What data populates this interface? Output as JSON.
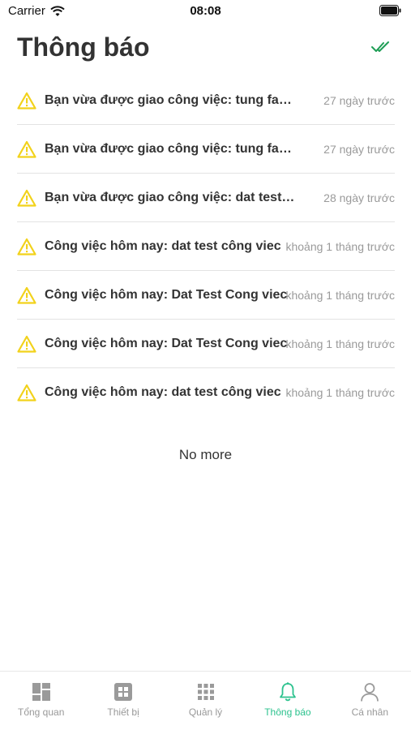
{
  "status_bar": {
    "carrier": "Carrier",
    "time": "08:08"
  },
  "header": {
    "title": "Thông báo",
    "mark_all_icon": "double-check-icon"
  },
  "notifications": [
    {
      "icon": "warning-icon",
      "message": "Bạn vừa được giao công việc: tung faker",
      "time_ago": "27 ngày trước"
    },
    {
      "icon": "warning-icon",
      "message": "Bạn vừa được giao công việc: tung faker",
      "time_ago": "27 ngày trước"
    },
    {
      "icon": "warning-icon",
      "message": "Bạn vừa được giao công việc: dat test công viec",
      "time_ago": "28 ngày trước"
    },
    {
      "icon": "warning-icon",
      "message": "Công việc hôm nay: dat test công viec",
      "time_ago": "khoảng 1 tháng trước"
    },
    {
      "icon": "warning-icon",
      "message": "Công việc hôm nay: Dat Test Cong viec",
      "time_ago": "khoảng 1 tháng trước"
    },
    {
      "icon": "warning-icon",
      "message": "Công việc hôm nay: Dat Test Cong viec",
      "time_ago": "khoảng 1 tháng trước"
    },
    {
      "icon": "warning-icon",
      "message": "Công việc hôm nay: dat test công viec",
      "time_ago": "khoảng 1 tháng trước"
    }
  ],
  "footer": {
    "no_more": "No more"
  },
  "tabbar": {
    "active_color": "#2cc28e",
    "inactive_color": "#999999",
    "tabs": [
      {
        "label": "Tổng quan",
        "icon": "dashboard-icon",
        "active": false
      },
      {
        "label": "Thiết bị",
        "icon": "device-icon",
        "active": false
      },
      {
        "label": "Quản lý",
        "icon": "grid-icon",
        "active": false
      },
      {
        "label": "Thông báo",
        "icon": "bell-icon",
        "active": true
      },
      {
        "label": "Cá nhân",
        "icon": "user-icon",
        "active": false
      }
    ]
  }
}
